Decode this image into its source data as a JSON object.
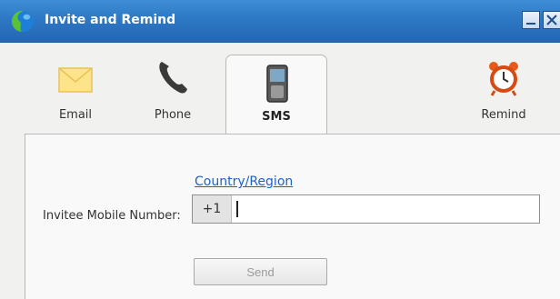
{
  "window": {
    "title": "Invite and Remind"
  },
  "tabs": {
    "email": {
      "label": "Email",
      "icon": "envelope-icon"
    },
    "phone": {
      "label": "Phone",
      "icon": "phone-handset-icon"
    },
    "sms": {
      "label": "SMS",
      "icon": "mobile-phone-icon",
      "active": true
    },
    "remind": {
      "label": "Remind",
      "icon": "alarm-clock-icon"
    }
  },
  "sms_form": {
    "country_link": "Country/Region",
    "mobile_label": "Invitee Mobile Number:",
    "country_code": "+1",
    "number_value": "",
    "send_label": "Send"
  },
  "colors": {
    "titlebar": "#2d78c4",
    "link": "#1d63c7",
    "panel_bg": "#f9f9f9",
    "window_bg": "#f1f1ef"
  }
}
